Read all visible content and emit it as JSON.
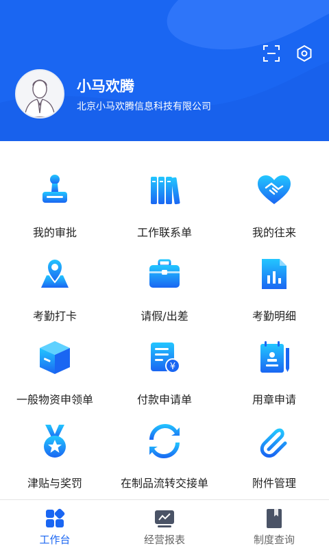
{
  "header": {
    "user_name": "小马欢腾",
    "company": "北京小马欢腾信息科技有限公司",
    "icons": [
      "scan-icon",
      "settings-icon",
      "avatar-icon"
    ]
  },
  "colors": {
    "brand": "#1a66f2",
    "icon_gradient_start": "#23c6ff",
    "icon_gradient_end": "#1a66f2",
    "tab_inactive": "#666666",
    "tab_icon_inactive": "#4a5366"
  },
  "grid": {
    "items": [
      {
        "label": "我的审批",
        "icon": "stamp-icon"
      },
      {
        "label": "工作联系单",
        "icon": "books-icon"
      },
      {
        "label": "我的往来",
        "icon": "handshake-heart-icon"
      },
      {
        "label": "考勤打卡",
        "icon": "location-pin-icon"
      },
      {
        "label": "请假/出差",
        "icon": "briefcase-icon"
      },
      {
        "label": "考勤明细",
        "icon": "report-chart-icon"
      },
      {
        "label": "一般物资申领单",
        "icon": "box-icon"
      },
      {
        "label": "付款申请单",
        "icon": "payment-doc-icon"
      },
      {
        "label": "用章申请",
        "icon": "seal-notebook-icon"
      },
      {
        "label": "津贴与奖罚",
        "icon": "medal-icon"
      },
      {
        "label": "在制品流转交接单",
        "icon": "refresh-icon"
      },
      {
        "label": "附件管理",
        "icon": "paperclip-icon"
      }
    ]
  },
  "tabbar": {
    "tabs": [
      {
        "label": "工作台",
        "icon": "workbench-icon",
        "active": true
      },
      {
        "label": "经营报表",
        "icon": "report-icon",
        "active": false
      },
      {
        "label": "制度查询",
        "icon": "bookmark-book-icon",
        "active": false
      }
    ]
  }
}
